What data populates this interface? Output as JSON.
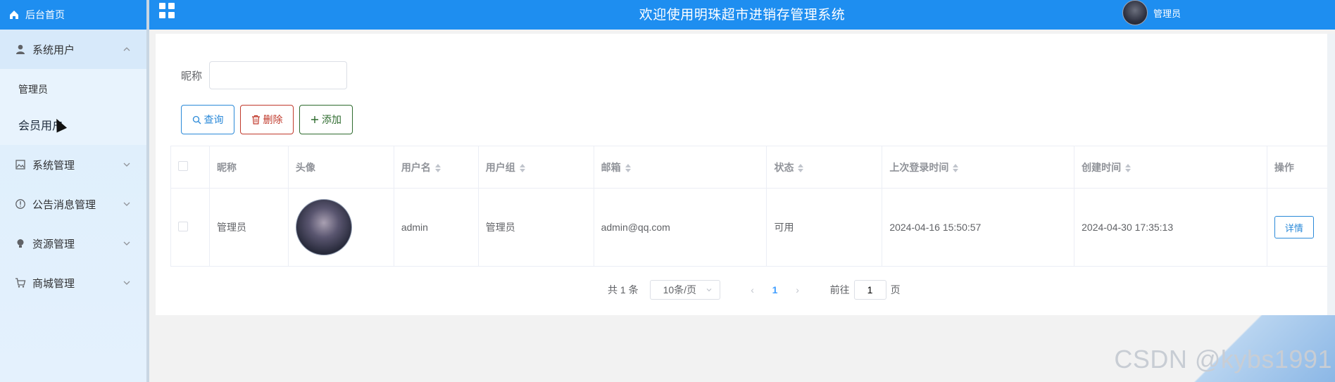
{
  "sidebar": {
    "home": "后台首页",
    "groups": [
      {
        "label": "系统用户",
        "items": [
          "管理员",
          "会员用户"
        ]
      },
      {
        "label": "系统管理"
      },
      {
        "label": "公告消息管理"
      },
      {
        "label": "资源管理"
      },
      {
        "label": "商城管理"
      }
    ]
  },
  "topbar": {
    "title": "欢迎使用明珠超市进销存管理系统",
    "user": "管理员"
  },
  "search": {
    "label": "昵称",
    "value": "",
    "placeholder": ""
  },
  "buttons": {
    "query": "查询",
    "delete": "删除",
    "add": "添加"
  },
  "table": {
    "headers": [
      "昵称",
      "头像",
      "用户名",
      "用户组",
      "邮箱",
      "状态",
      "上次登录时间",
      "创建时间",
      "操作"
    ],
    "rows": [
      {
        "nickname": "管理员",
        "username": "admin",
        "group": "管理员",
        "email": "admin@qq.com",
        "status": "可用",
        "last_login": "2024-04-16 15:50:57",
        "created": "2024-04-30 17:35:13",
        "action": "详情"
      }
    ]
  },
  "pager": {
    "total": "共 1 条",
    "page_size": "10条/页",
    "current": "1",
    "goto_prefix": "前往",
    "goto_value": "1",
    "goto_suffix": "页"
  },
  "watermark": "CSDN @kybs1991"
}
